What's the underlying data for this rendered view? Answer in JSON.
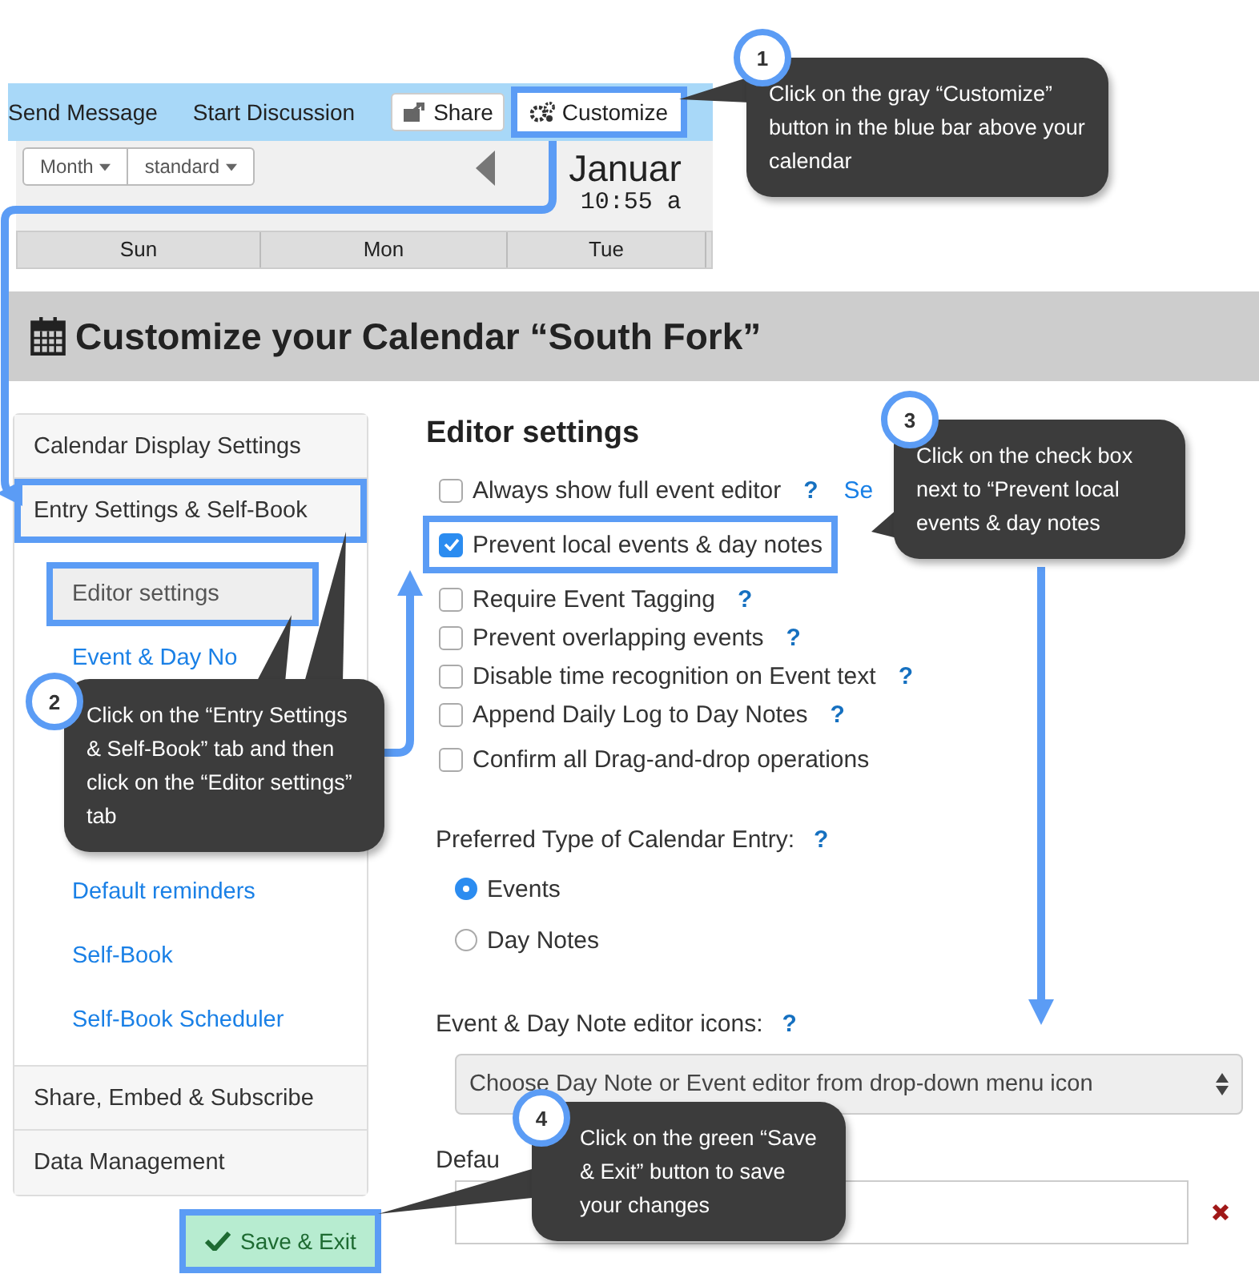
{
  "toolbar": {
    "links": [
      {
        "label": "Send Message"
      },
      {
        "label": "Start Discussion"
      }
    ],
    "buttons": [
      {
        "label": "Share",
        "highlighted": false
      },
      {
        "label": "Customize",
        "highlighted": true
      }
    ]
  },
  "calendar_preview": {
    "view_buttons": [
      "Month",
      "standard"
    ],
    "month": "Januar",
    "time": "10:55 a",
    "days": [
      "Sun",
      "Mon",
      "Tue"
    ]
  },
  "page_title": "Customize your Calendar “South Fork”",
  "sidebar": {
    "items": [
      {
        "label": "Calendar Display Settings",
        "highlighted": false
      },
      {
        "label": "Entry Settings & Self-Book",
        "highlighted": true,
        "children": [
          {
            "label": "Editor settings",
            "selected": true,
            "highlighted": true
          },
          {
            "label": "Event & Day No",
            "selected": false,
            "highlighted": false
          },
          {
            "label": "Default reminders",
            "selected": false,
            "highlighted": false
          },
          {
            "label": "Self-Book",
            "selected": false,
            "highlighted": false
          },
          {
            "label": "Self-Book Scheduler",
            "selected": false,
            "highlighted": false
          }
        ]
      },
      {
        "label": "Share, Embed & Subscribe",
        "highlighted": false
      },
      {
        "label": "Data Management",
        "highlighted": false
      }
    ]
  },
  "editor": {
    "heading": "Editor settings",
    "options": [
      {
        "label": "Always show full event editor",
        "checked": false,
        "highlighted": false,
        "help": "?",
        "link": "Se"
      },
      {
        "label": "Prevent local events & day notes",
        "checked": true,
        "highlighted": true
      },
      {
        "label": "Require Event Tagging",
        "checked": false,
        "highlighted": false,
        "help": "?"
      },
      {
        "label": "Prevent overlapping events",
        "checked": false,
        "highlighted": false,
        "help": "?"
      },
      {
        "label": "Disable time recognition on Event text",
        "checked": false,
        "highlighted": false,
        "help": "?"
      },
      {
        "label": "Append Daily Log to Day Notes",
        "checked": false,
        "highlighted": false,
        "help": "?"
      },
      {
        "label": "Confirm all Drag-and-drop operations",
        "checked": false,
        "highlighted": false
      }
    ],
    "entry_type": {
      "label": "Preferred Type of Calendar Entry:",
      "help": "?",
      "options": [
        {
          "label": "Events",
          "selected": true
        },
        {
          "label": "Day Notes",
          "selected": false
        }
      ]
    },
    "editor_icons": {
      "label": "Event & Day Note editor icons:",
      "help": "?",
      "value": "Choose Day Note or Event editor from drop-down menu icon"
    },
    "default_field": {
      "label": "Defau"
    }
  },
  "save_button": {
    "label": "Save & Exit",
    "highlighted": true
  },
  "callouts": [
    {
      "number": "1",
      "text": "Click on the gray “Customize” button in the blue bar above your calendar"
    },
    {
      "number": "2",
      "text": "Click on the “Entry Settings & Self-Book” tab and then click on the “Editor settings” tab"
    },
    {
      "number": "3",
      "text": "Click on the check box next to “Prevent local events & day notes"
    },
    {
      "number": "4",
      "text": "Click on the green “Save & Exit” button to save your changes"
    }
  ]
}
